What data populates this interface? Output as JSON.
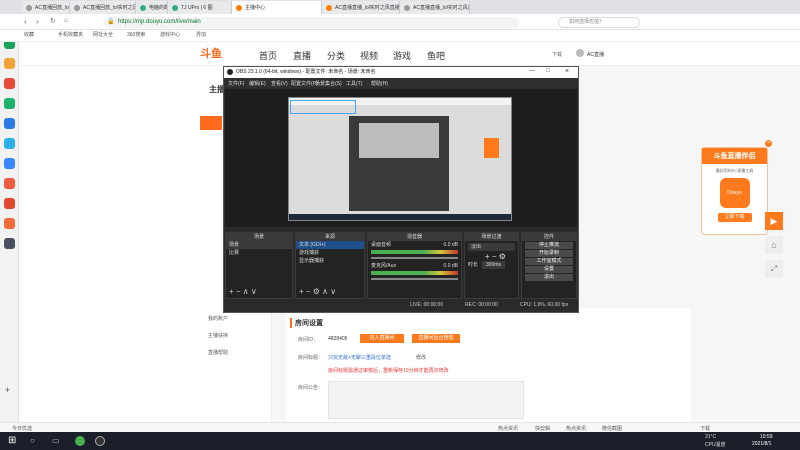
{
  "tabs": [
    {
      "label": "AC直播回放_lol实时之风直播_",
      "color": "#999"
    },
    {
      "label": "AC直播回放_lol实时之风直播_",
      "color": "#999"
    },
    {
      "label": "电脑的数 | 今天吉他",
      "color": "#3a8"
    },
    {
      "label": "TJ UPro | 6 图",
      "color": "#3a8"
    },
    {
      "label": "主播中心",
      "color": "#ff7a00",
      "active": true
    },
    {
      "label": "AC直播直播_lol实时之风直播_",
      "color": "#ff7a00"
    },
    {
      "label": "AC直播直播_lol实时之风直播_",
      "color": "#999"
    }
  ],
  "url": "https://mp.douyu.com/live/main",
  "search_placeholder": "如何选择优值？",
  "bookmarks": [
    "收藏",
    "手机收藏夹",
    "网址大全",
    "360搜索",
    "游戏中心",
    "界加"
  ],
  "douyu": {
    "logo": "斗鱼",
    "nav": [
      "首页",
      "直播",
      "分类",
      "视频",
      "游戏",
      "鱼吧"
    ],
    "user": "AC直播",
    "download": "下载",
    "side_title": "主播",
    "side_items": [
      "我的账户",
      "主播扶持",
      "直播帮助"
    ],
    "room_settings": "房间设置",
    "room_id_label": "房间ID：",
    "room_id": "4828405",
    "enter_room": "进入直播间",
    "backend": "直播间后台管理",
    "room_title_label": "房间标题：",
    "room_title": "只玩无敌+无聊三重段位单选",
    "edit": "修改",
    "warn": "房间标题需通过审核后，重新保存10分钟才能再次修改",
    "notice_label": "房间公告："
  },
  "obs": {
    "title": "OBS 23.1.0 (64-bit, windows) - 配置文件: 未命名 - 场景: 未命名",
    "menu": [
      "文件(F)",
      "编辑(E)",
      "查看(V)",
      "配置文件(P)",
      "场景集合(S)",
      "工具(T)",
      "帮助(H)"
    ],
    "docks": {
      "scenes": "场景",
      "sources": "来源",
      "mixer": "混音器",
      "transitions": "场景过渡",
      "controls": "控件"
    },
    "scenes": [
      "场景",
      "比赛"
    ],
    "sources": [
      "文本 (GDI+)",
      "游戏捕获",
      "显示器捕获"
    ],
    "mixer": [
      {
        "name": "桌面音频",
        "db": "0.0 dB"
      },
      {
        "name": "麦克风/Aux",
        "db": "0.0 dB"
      }
    ],
    "transition": "淡出",
    "duration_label": "时长",
    "duration": "300ms",
    "controls": [
      "停止推流",
      "开始录制",
      "工作室模式",
      "设置",
      "退出"
    ],
    "status": {
      "live": "LIVE: 00:00:00",
      "rec": "REC: 00:00:00",
      "cpu": "CPU: 1.9%, 60.00 fps"
    }
  },
  "ad": {
    "title": "斗鱼直播伴侣",
    "sub": "最好用的PC直播工具",
    "btn": "立即下载",
    "logo": "Douyu"
  },
  "statusbar": {
    "left": "今日优选",
    "items": [
      "热点资讯",
      "快剪辑",
      "热点资讯",
      "微信截图"
    ],
    "right": "下载"
  },
  "taskbar": {
    "weather": "31°C",
    "cpu": "CPU温度",
    "time": "10:59",
    "date": "2021/8/1"
  }
}
